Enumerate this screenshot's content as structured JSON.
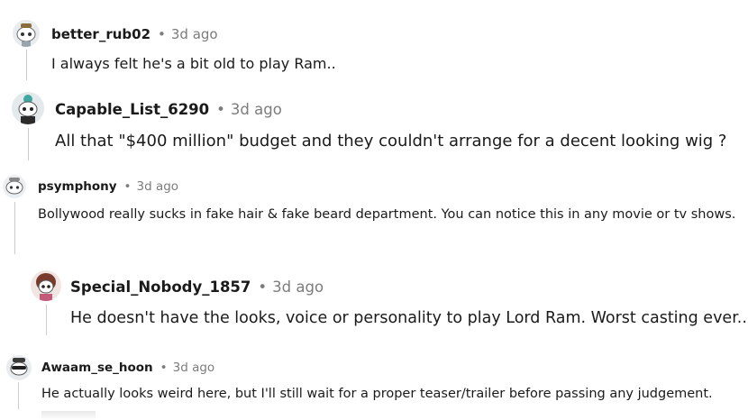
{
  "comments": [
    {
      "username": "better_rub02",
      "separator": "•",
      "time": "3d ago",
      "text": "I always felt he's a bit old to play Ram.."
    },
    {
      "username": "Capable_List_6290",
      "separator": "•",
      "time": "3d ago",
      "text": "All that \"$400 million\" budget and they couldn't arrange for a decent looking wig ?"
    },
    {
      "username": "psymphony",
      "separator": "•",
      "time": "3d ago",
      "text": "Bollywood really sucks in fake hair & fake beard department. You can notice this in any movie or tv shows."
    },
    {
      "username": "Special_Nobody_1857",
      "separator": "•",
      "time": "3d ago",
      "text": "He doesn't have the looks, voice or personality to play Lord Ram. Worst casting ever..."
    },
    {
      "username": "Awaam_se_hoon",
      "separator": "•",
      "time": "3d ago",
      "text": "He actually looks weird here, but I'll still wait for a proper teaser/trailer before passing any judgement."
    }
  ],
  "icons": {
    "avatar": "snoo-avatar-icon"
  },
  "colors": {
    "meta_gray": "#7c7c7c",
    "thread_line": "#c9cdd1",
    "text": "#1a1a1b"
  }
}
